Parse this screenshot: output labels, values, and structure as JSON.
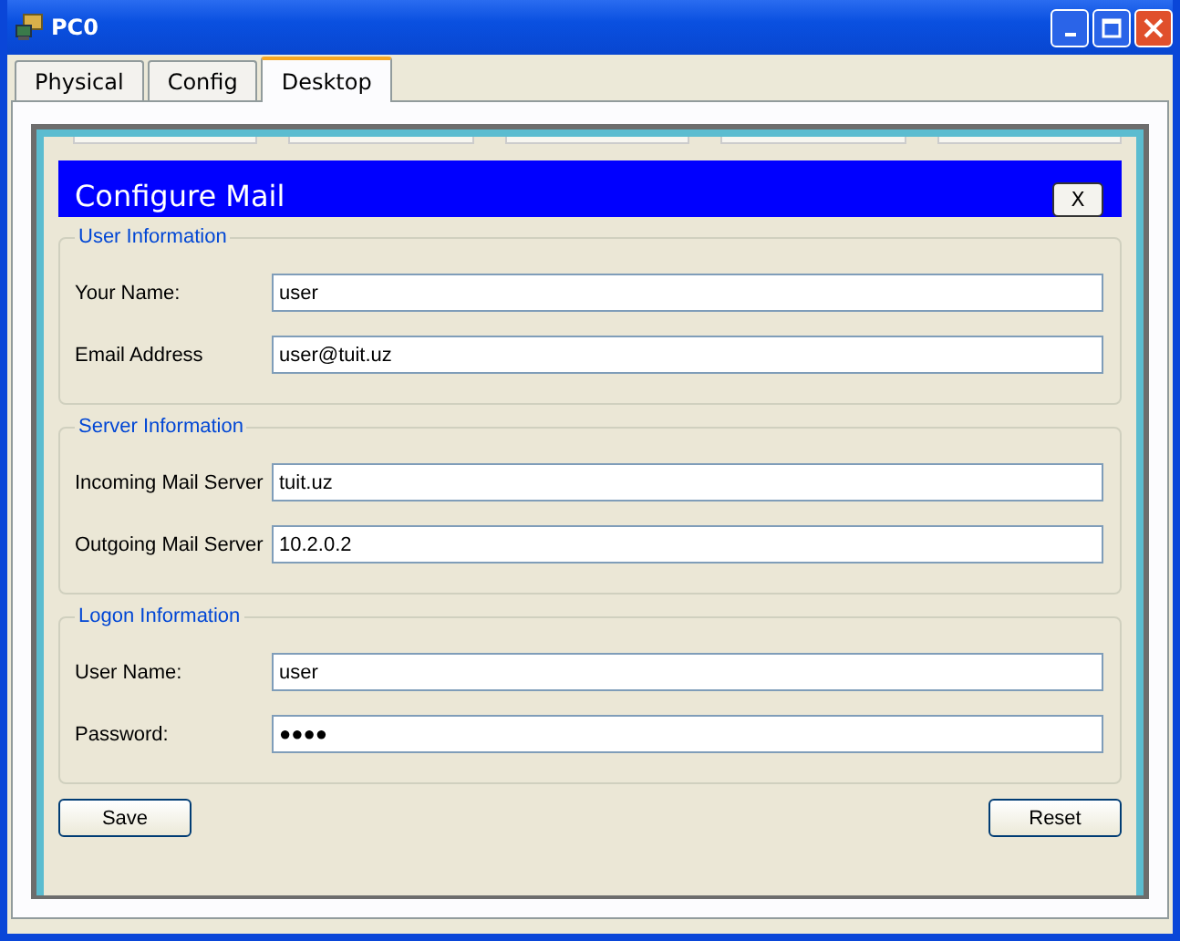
{
  "window": {
    "title": "PC0"
  },
  "tabs": [
    {
      "label": "Physical",
      "selected": false
    },
    {
      "label": "Config",
      "selected": false
    },
    {
      "label": "Desktop",
      "selected": true
    }
  ],
  "dialog": {
    "title": "Configure Mail",
    "close_label": "X",
    "sections": [
      {
        "title": "User Information",
        "fields": [
          {
            "label": "Your Name:",
            "value": "user"
          },
          {
            "label": "Email Address",
            "value": "user@tuit.uz"
          }
        ]
      },
      {
        "title": "Server Information",
        "fields": [
          {
            "label": "Incoming Mail Server",
            "value": "tuit.uz"
          },
          {
            "label": "Outgoing Mail Server",
            "value": "10.2.0.2"
          }
        ]
      },
      {
        "title": "Logon Information",
        "fields": [
          {
            "label": "User Name:",
            "value": "user"
          },
          {
            "label": "Password:",
            "value": "●●●●"
          }
        ]
      }
    ],
    "buttons": [
      "Save",
      "Reset"
    ]
  }
}
